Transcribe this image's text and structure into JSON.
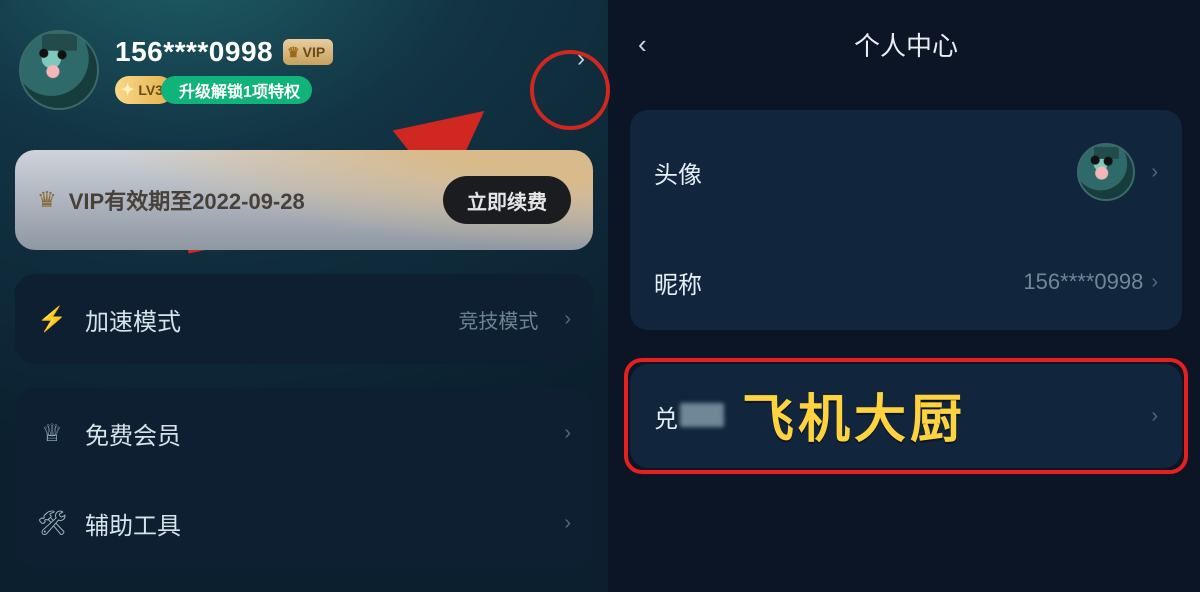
{
  "left": {
    "username": "156****0998",
    "vip_label": "VIP",
    "level_text": "LV3",
    "upgrade_text": "升级解锁1项特权",
    "vip_card": {
      "text": "VIP有效期至2022-09-28",
      "renew_label": "立即续费"
    },
    "rows": {
      "accel": {
        "label": "加速模式",
        "value": "竞技模式"
      },
      "free": {
        "label": "免费会员"
      },
      "tools": {
        "label": "辅助工具"
      }
    }
  },
  "right": {
    "title": "个人中心",
    "rows": {
      "avatar": {
        "label": "头像"
      },
      "nick": {
        "label": "昵称",
        "value": "156****0998"
      },
      "code": {
        "label": "兑换码"
      }
    }
  },
  "annotation": {
    "overlay_text": "飞机大厨"
  }
}
